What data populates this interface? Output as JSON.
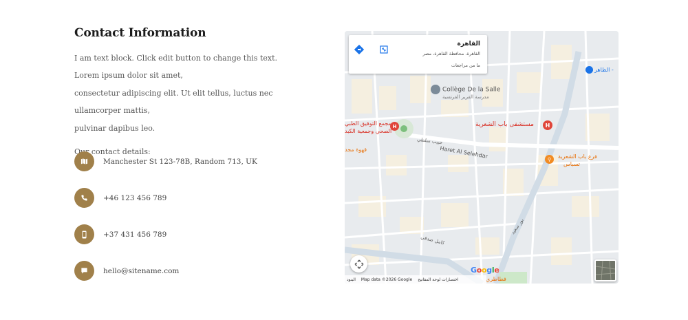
{
  "contact": {
    "title": "Contact Information",
    "para_line1": "I am text block. Click edit button to change this text. Lorem ipsum dolor sit amet,",
    "para_line2": "consectetur adipiscing elit. Ut elit tellus, luctus nec ullamcorper mattis,",
    "para_line3": "pulvinar dapibus leo.",
    "details_label": "Our contact details:",
    "items": [
      {
        "icon": "map-icon",
        "text": "Manchester St 123-78B, Random 713, UK"
      },
      {
        "icon": "phone-icon",
        "text": "+46 123 456 789"
      },
      {
        "icon": "mobile-icon",
        "text": "+37 431 456 789"
      },
      {
        "icon": "chat-icon",
        "text": "hello@sitename.com"
      }
    ],
    "accent": "#a0804a"
  },
  "map": {
    "card": {
      "title": "القاهرة",
      "address": "القاهرة، محافظة القاهرة، مصر",
      "reviews": "ما من مراجعات"
    },
    "labels": {
      "college_fr": "Collège De la Salle",
      "college_ar": "مدرسة الفرير الفرنسية",
      "hospital_1": "مستشفى باب الشعرية",
      "hospital_2a": "مجمع التوفيق الطبي",
      "hospital_2b": "الصحي وجمعية الكبد",
      "cafe": "قهوة مجد",
      "branch_a": "فرع باب الشعرية",
      "branch_b": "تسباس",
      "street_main": "Haret Al Selehdar",
      "street_1": "حبيب سلطي",
      "street_2": "كامل صدقي",
      "street_3": "بور سعيد",
      "top_right": "الظاهر -",
      "bottom_poi": "فطاطري"
    },
    "footer": {
      "data": "Map data ©2026 Google",
      "shortcuts": "اختصارات لوحة المفاتيح",
      "terms": "البنود"
    },
    "google": "Google"
  }
}
